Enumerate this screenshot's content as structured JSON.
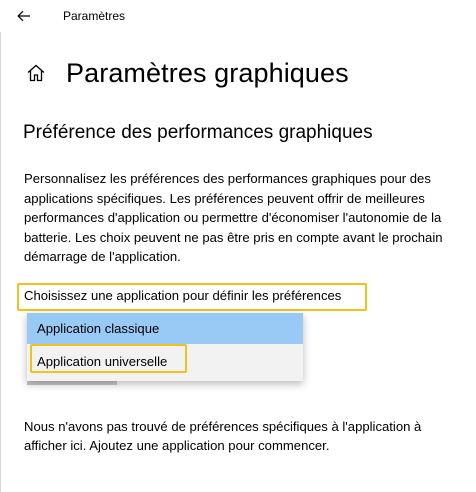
{
  "window": {
    "title": "Paramètres"
  },
  "header": {
    "title": "Paramètres graphiques"
  },
  "section": {
    "title": "Préférence des performances graphiques",
    "description": "Personnalisez les préférences des performances graphiques pour des applications spécifiques. Les préférences peuvent offrir de meilleures performances d'application ou permettre d'économiser l'autonomie de la batterie. Les choix peuvent ne pas être pris en compte avant le prochain démarrage de l'application."
  },
  "chooser": {
    "label": "Choisissez une application pour définir les préférences",
    "options": [
      {
        "label": "Application classique",
        "selected": true
      },
      {
        "label": "Application universelle",
        "selected": false
      }
    ]
  },
  "empty_message": "Nous n'avons pas trouvé de préférences spécifiques à l'application à afficher ici. Ajoutez une application pour commencer.",
  "colors": {
    "highlight": "#f2c11e",
    "selected_option": "#99c9f5",
    "dropdown_bg": "#f2f2f2"
  },
  "icons": {
    "back": "back-arrow-icon",
    "home": "home-icon"
  }
}
